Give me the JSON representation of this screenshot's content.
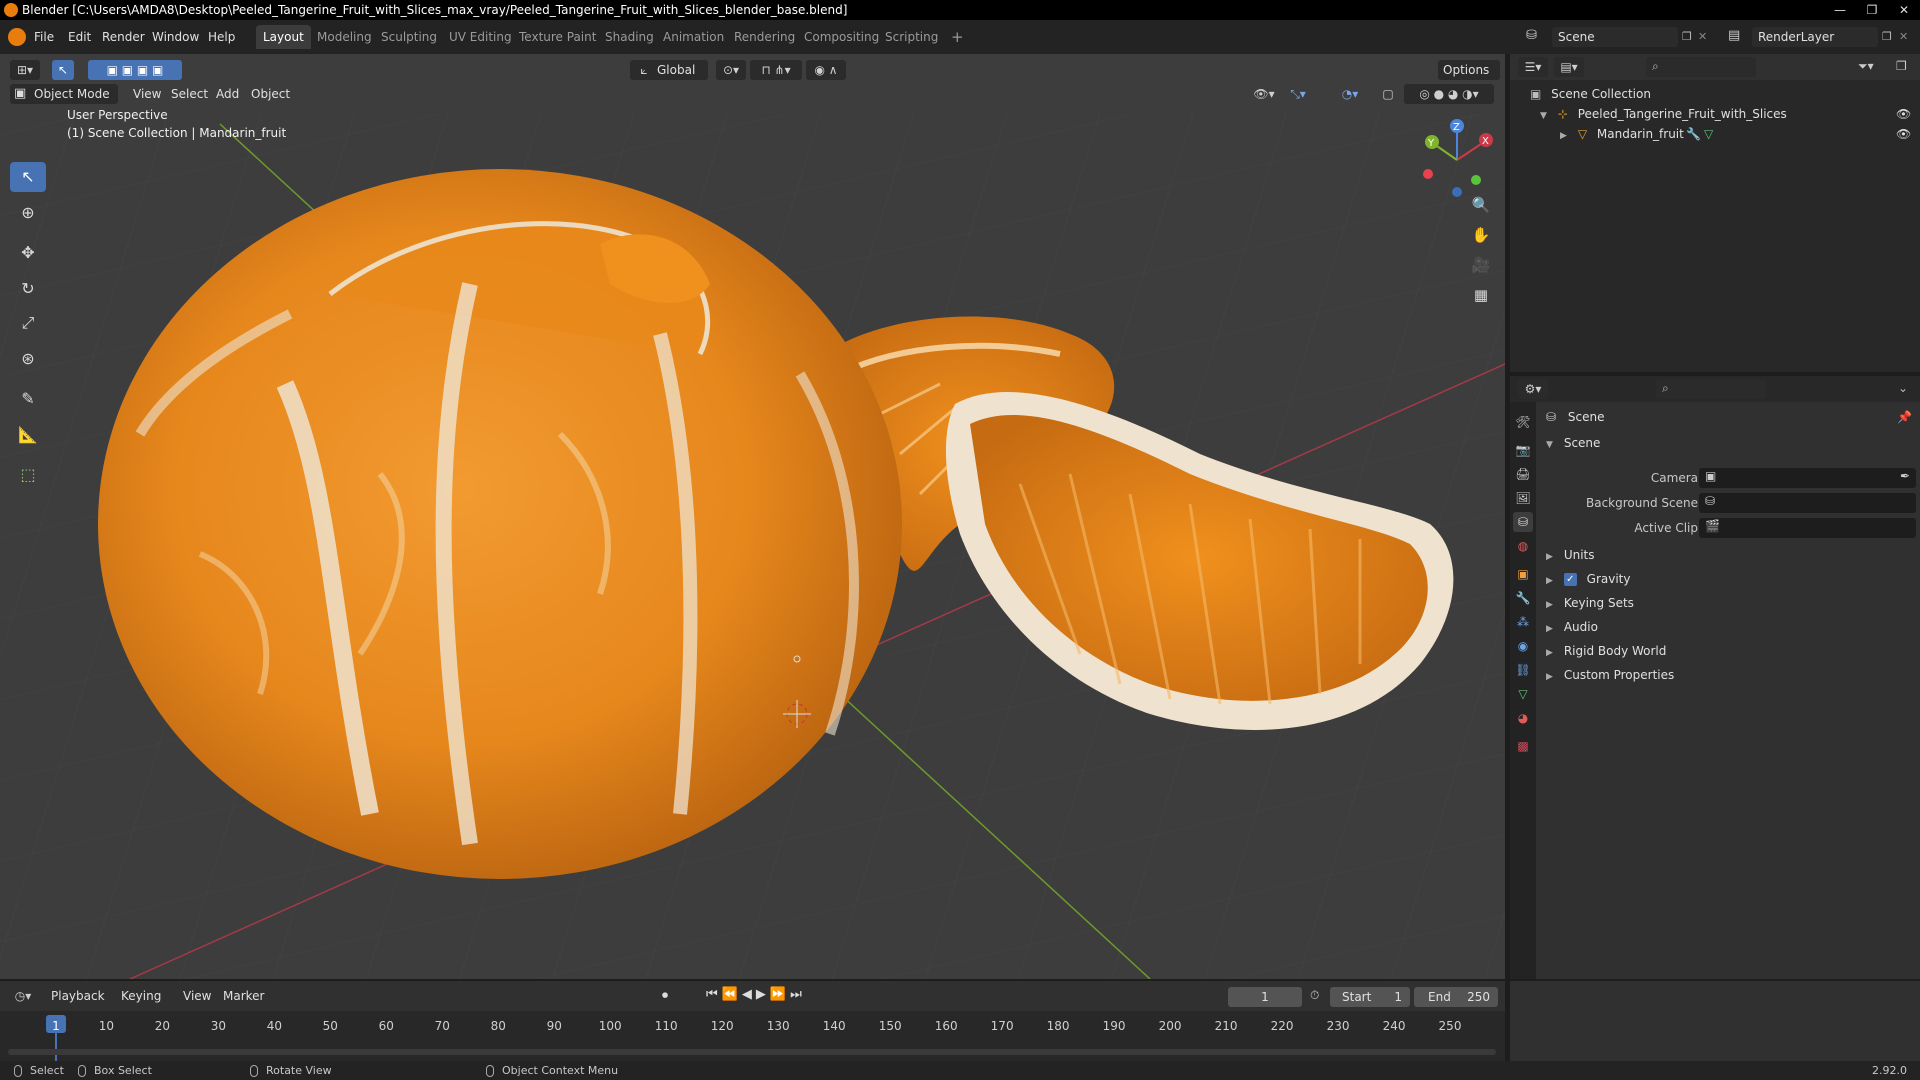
{
  "window": {
    "title": "Blender [C:\\Users\\AMDA8\\Desktop\\Peeled_Tangerine_Fruit_with_Slices_max_vray/Peeled_Tangerine_Fruit_with_Slices_blender_base.blend]",
    "controls": [
      "—",
      "❐",
      "✕"
    ]
  },
  "menu": {
    "items": [
      "File",
      "Edit",
      "Render",
      "Window",
      "Help"
    ]
  },
  "workspaces": {
    "tabs": [
      "Layout",
      "Modeling",
      "Sculpting",
      "UV Editing",
      "Texture Paint",
      "Shading",
      "Animation",
      "Rendering",
      "Compositing",
      "Scripting"
    ],
    "active": "Layout",
    "add": "+"
  },
  "scene_selector": {
    "value": "Scene"
  },
  "layer_selector": {
    "value": "RenderLayer"
  },
  "viewport": {
    "mode": "Object Mode",
    "menus": [
      "View",
      "Select",
      "Add",
      "Object"
    ],
    "orientation": "Global",
    "options": "Options",
    "perspective": "User Perspective",
    "collection_info": "(1) Scene Collection | Mandarin_fruit",
    "axis_labels": {
      "x": "X",
      "y": "Y",
      "z": "Z"
    },
    "colors": {
      "background": "#3d3d3d",
      "grid": "#474747",
      "axis_x": "#a33a48",
      "axis_y": "#6e9a2a",
      "peel": "#e8891a",
      "pith": "#efe3cf"
    }
  },
  "outliner": {
    "search_placeholder": "",
    "root": "Scene Collection",
    "rows": [
      {
        "label": "Peeled_Tangerine_Fruit_with_Slices"
      },
      {
        "label": "Mandarin_fruit"
      }
    ]
  },
  "properties": {
    "context": "Scene",
    "panel": "Scene",
    "fields": [
      {
        "label": "Camera"
      },
      {
        "label": "Background Scene"
      },
      {
        "label": "Active Clip"
      }
    ],
    "sections": [
      "Units",
      "Gravity",
      "Keying Sets",
      "Audio",
      "Rigid Body World",
      "Custom Properties"
    ],
    "gravity_checked": true
  },
  "timeline": {
    "menus": [
      "Playback",
      "Keying",
      "View",
      "Marker"
    ],
    "current_frame": "1",
    "start_label": "Start",
    "start_value": "1",
    "end_label": "End",
    "end_value": "250",
    "ticks": [
      "1",
      "10",
      "20",
      "30",
      "40",
      "50",
      "60",
      "70",
      "80",
      "90",
      "100",
      "110",
      "120",
      "130",
      "140",
      "150",
      "160",
      "170",
      "180",
      "190",
      "200",
      "210",
      "220",
      "230",
      "240",
      "250"
    ]
  },
  "statusbar": {
    "select": "Select",
    "box_select": "Box Select",
    "rotate_view": "Rotate View",
    "context_menu": "Object Context Menu",
    "version": "2.92.0"
  }
}
